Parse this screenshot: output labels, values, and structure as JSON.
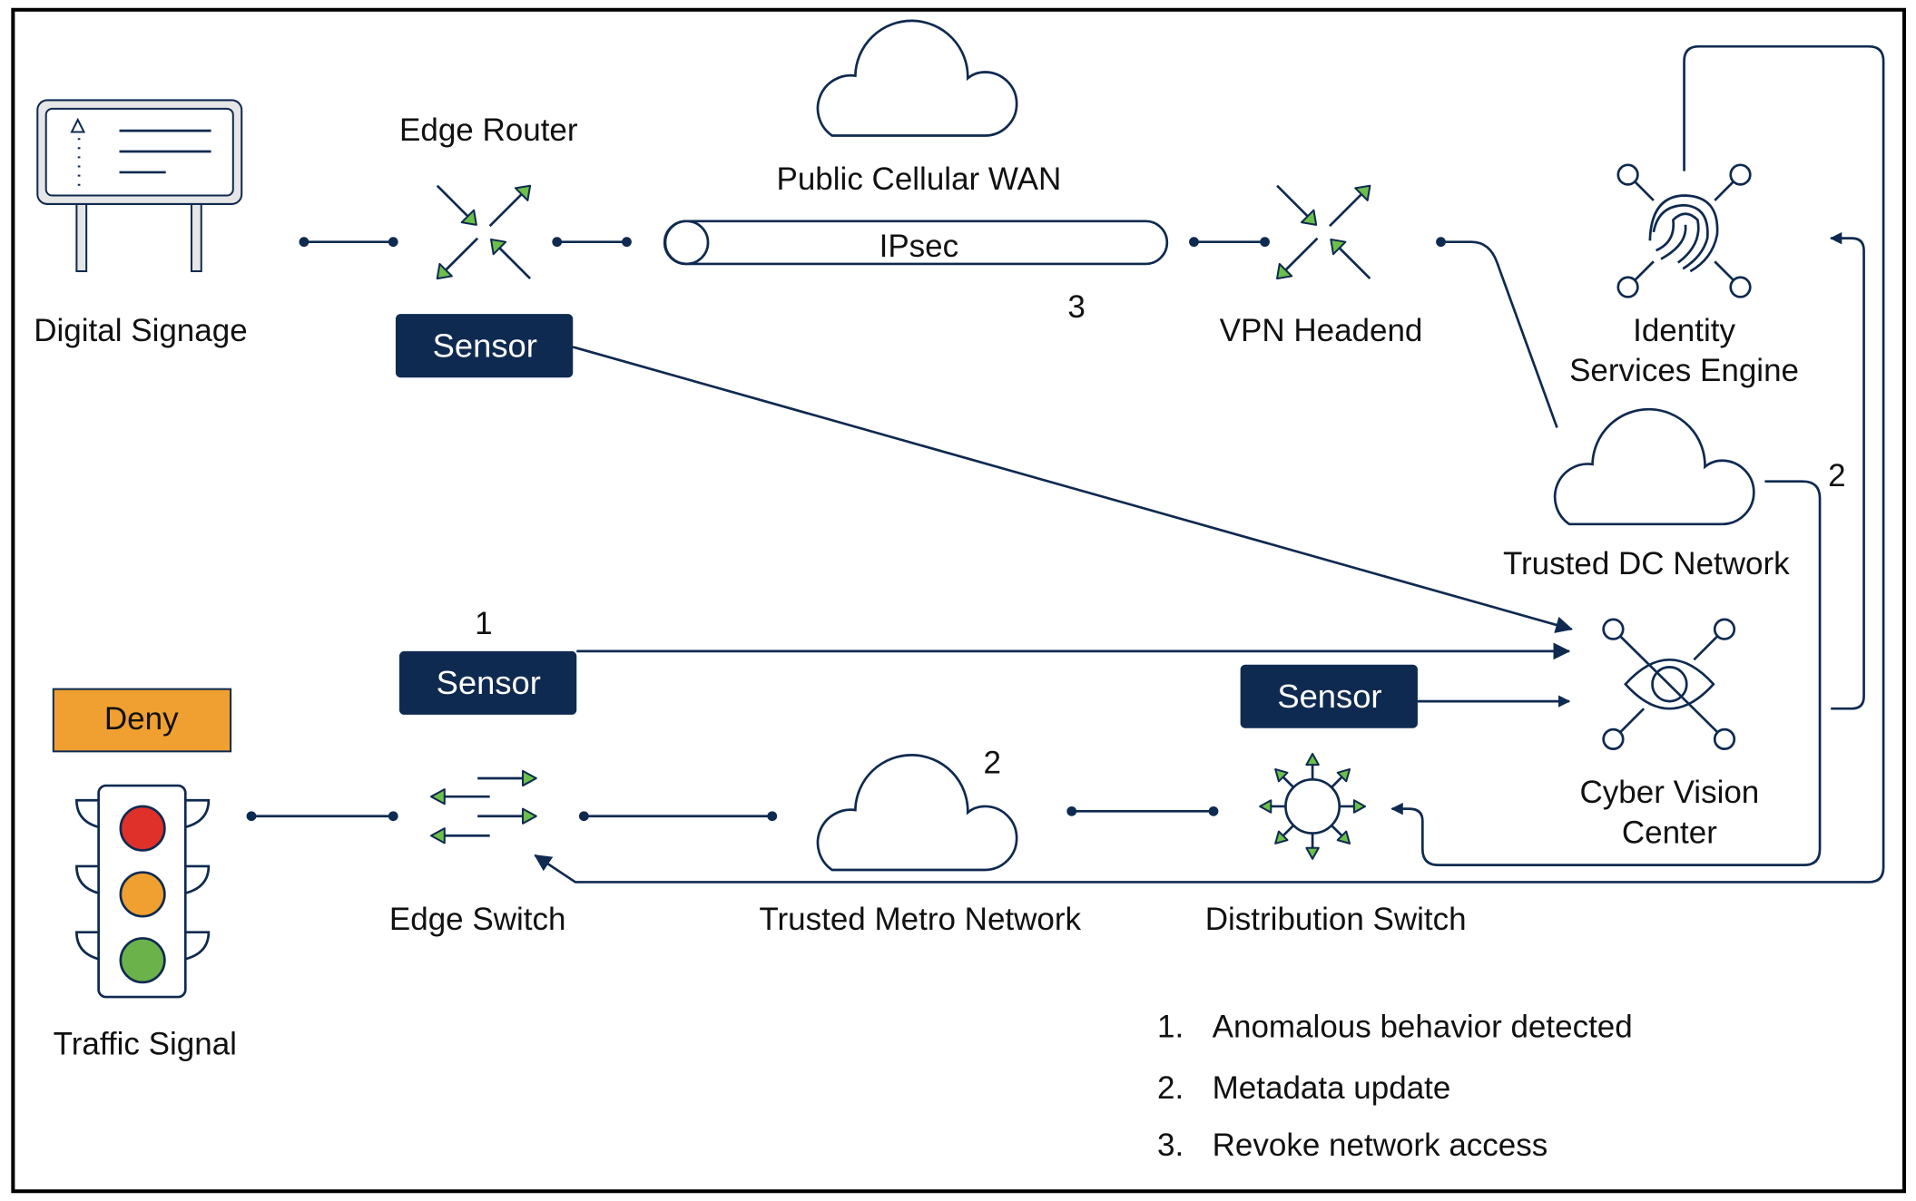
{
  "nodes": {
    "digital_signage": "Digital Signage",
    "edge_router": "Edge Router",
    "public_cellular_wan": "Public Cellular WAN",
    "ipsec": "IPsec",
    "vpn_headend": "VPN Headend",
    "ise_line1": "Identity",
    "ise_line2": "Services Engine",
    "trusted_dc": "Trusted DC Network",
    "cvc_line1": "Cyber Vision",
    "cvc_line2": "Center",
    "traffic_signal": "Traffic Signal",
    "edge_switch": "Edge Switch",
    "trusted_metro": "Trusted Metro Network",
    "distribution_switch": "Distribution Switch"
  },
  "sensors": [
    "Sensor",
    "Sensor",
    "Sensor"
  ],
  "deny_badge": "Deny",
  "step_markers": {
    "top_tunnel": "3",
    "sensor_1": "1",
    "metro": "2",
    "dc": "2"
  },
  "legend": [
    {
      "num": "1.",
      "text": "Anomalous behavior detected"
    },
    {
      "num": "2.",
      "text": "Metadata update"
    },
    {
      "num": "3.",
      "text": "Revoke network access"
    }
  ],
  "colors": {
    "navy": "#0f2a50",
    "green": "#6cc04a",
    "deny": "#f0a030",
    "red": "#e0302a",
    "amber": "#f0a030",
    "light_green": "#6cb24a"
  },
  "icons": [
    "digital-signage-icon",
    "router-icon",
    "cloud-icon",
    "vpn-icon",
    "fingerprint-icon",
    "cloud-icon",
    "eye-icon",
    "traffic-light-icon",
    "switch-icon",
    "cloud-icon",
    "distribution-switch-icon"
  ]
}
